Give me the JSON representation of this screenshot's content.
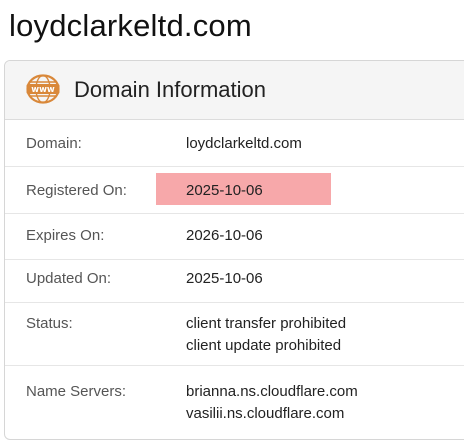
{
  "site_title": "loydclarkeltd.com",
  "card": {
    "title": "Domain Information",
    "icon": "www-globe-icon",
    "accent_color": "#d9883a",
    "highlight_color": "#f7a8aa"
  },
  "rows": {
    "domain": {
      "label": "Domain:",
      "value": "loydclarkeltd.com"
    },
    "registered": {
      "label": "Registered On:",
      "value": "2025-10-06"
    },
    "expires": {
      "label": "Expires On:",
      "value": "2026-10-06"
    },
    "updated": {
      "label": "Updated On:",
      "value": "2025-10-06"
    },
    "status": {
      "label": "Status:",
      "values": [
        "client transfer prohibited",
        "client update prohibited"
      ]
    },
    "name_servers": {
      "label": "Name Servers:",
      "values": [
        "brianna.ns.cloudflare.com",
        "vasilii.ns.cloudflare.com"
      ]
    }
  }
}
